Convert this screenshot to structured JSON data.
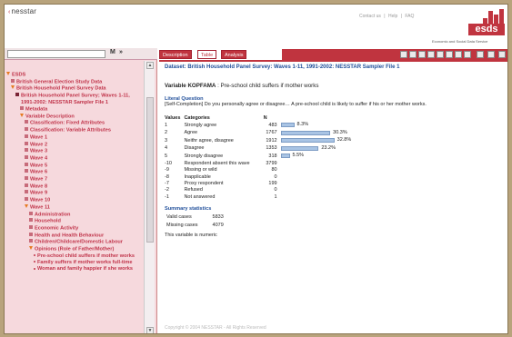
{
  "header": {
    "logo_text": "nesstar",
    "top_links": [
      "Contact us",
      "|",
      "Help",
      "|",
      "FAQ"
    ],
    "brand": "esds",
    "brand_tagline": "Economic and Social Data Service"
  },
  "search": {
    "button_label": "M",
    "next_label": "»"
  },
  "tabs": [
    {
      "label": "Description",
      "active": false
    },
    {
      "label": "Table",
      "active": true
    },
    {
      "label": "Analysis",
      "active": false
    }
  ],
  "tree": [
    {
      "label": "ESDS",
      "indent": 0,
      "bullet": "tri"
    },
    {
      "label": "British General Election Study Data",
      "indent": 1,
      "bullet": "sq"
    },
    {
      "label": "British Household Panel Survey Data",
      "indent": 1,
      "bullet": "tri"
    },
    {
      "label": "British Household Panel Survey; Waves 1-11, 1991-2002: NESSTAR Sampler File 1",
      "indent": 2,
      "bullet": "sqdark"
    },
    {
      "label": "Metadata",
      "indent": 3,
      "bullet": "sq"
    },
    {
      "label": "Variable Description",
      "indent": 3,
      "bullet": "tri"
    },
    {
      "label": "Classification: Fixed Attributes",
      "indent": 4,
      "bullet": "sq"
    },
    {
      "label": "Classification: Variable Attributes",
      "indent": 4,
      "bullet": "sq"
    },
    {
      "label": "Wave 1",
      "indent": 4,
      "bullet": "sq"
    },
    {
      "label": "Wave 2",
      "indent": 4,
      "bullet": "sq"
    },
    {
      "label": "Wave 3",
      "indent": 4,
      "bullet": "sq"
    },
    {
      "label": "Wave 4",
      "indent": 4,
      "bullet": "sq"
    },
    {
      "label": "Wave 5",
      "indent": 4,
      "bullet": "sq"
    },
    {
      "label": "Wave 6",
      "indent": 4,
      "bullet": "sq"
    },
    {
      "label": "Wave 7",
      "indent": 4,
      "bullet": "sq"
    },
    {
      "label": "Wave 8",
      "indent": 4,
      "bullet": "sq"
    },
    {
      "label": "Wave 9",
      "indent": 4,
      "bullet": "sq"
    },
    {
      "label": "Wave 10",
      "indent": 4,
      "bullet": "sq"
    },
    {
      "label": "Wave 11",
      "indent": 4,
      "bullet": "tri"
    },
    {
      "label": "Administration",
      "indent": 5,
      "bullet": "sq"
    },
    {
      "label": "Household",
      "indent": 5,
      "bullet": "sq"
    },
    {
      "label": "Economic Activity",
      "indent": 5,
      "bullet": "sq"
    },
    {
      "label": "Health and Health Behaviour",
      "indent": 5,
      "bullet": "sq"
    },
    {
      "label": "Children/Childcare/Domestic Labour",
      "indent": 5,
      "bullet": "sq"
    },
    {
      "label": "Opinions (Role of Father/Mother)",
      "indent": 5,
      "bullet": "tri"
    },
    {
      "label": "Pre-school child suffers if mother works",
      "indent": 6,
      "bullet": "dot"
    },
    {
      "label": "Family suffers if mother works full-time",
      "indent": 6,
      "bullet": "dot"
    },
    {
      "label": "Woman and family happier if she works",
      "indent": 6,
      "bullet": "dot"
    }
  ],
  "content": {
    "dataset_title": "Dataset: British Household Panel Survey: Waves 1-11, 1991-2002: NESSTAR Sampler File 1",
    "variable_name": "Variable KOPFAMA",
    "variable_label": " : Pre-school child suffers if mother works",
    "literal_question_heading": "Literal Question",
    "literal_question": "[Self-Completion] Do you personally agree or disagree… A pre-school child is likely to suffer if his or her mother works.",
    "col_values": "Values",
    "col_categories": "Categories",
    "col_n": "N",
    "rows": [
      {
        "value": "1",
        "category": "Strongly agree",
        "n": "483",
        "pct_label": "8.3%",
        "pct": 8.3
      },
      {
        "value": "2",
        "category": "Agree",
        "n": "1767",
        "pct_label": "30.3%",
        "pct": 30.3
      },
      {
        "value": "3",
        "category": "Neithr agree, disagree",
        "n": "1912",
        "pct_label": "32.8%",
        "pct": 32.8
      },
      {
        "value": "4",
        "category": "Disagree",
        "n": "1353",
        "pct_label": "23.2%",
        "pct": 23.2
      },
      {
        "value": "5",
        "category": "Strongly disagree",
        "n": "318",
        "pct_label": "5.5%",
        "pct": 5.5
      },
      {
        "value": "-10",
        "category": "Respondent absent this wave",
        "n": "3799",
        "pct_label": "",
        "pct": 0
      },
      {
        "value": "-9",
        "category": "Missing or wild",
        "n": "80",
        "pct_label": "",
        "pct": 0
      },
      {
        "value": "-8",
        "category": "Inapplicable",
        "n": "0",
        "pct_label": "",
        "pct": 0
      },
      {
        "value": "-7",
        "category": "Proxy respondent",
        "n": "199",
        "pct_label": "",
        "pct": 0
      },
      {
        "value": "-2",
        "category": "Refused",
        "n": "0",
        "pct_label": "",
        "pct": 0
      },
      {
        "value": "-1",
        "category": "Not answered",
        "n": "1",
        "pct_label": "",
        "pct": 0
      }
    ],
    "summary_heading": "Summary statistics",
    "summary": [
      {
        "label": "Valid cases",
        "value": "5833"
      },
      {
        "label": "Missing cases",
        "value": "4079"
      }
    ],
    "note": "This variable is numeric"
  },
  "footer": "Copyright © 2004 NESSTAR - All Rights Reserved",
  "colors": {
    "accent": "#c0343f",
    "bar": "#a9c4e4",
    "link": "#1f4e9a",
    "tree_text": "#c0344a"
  }
}
